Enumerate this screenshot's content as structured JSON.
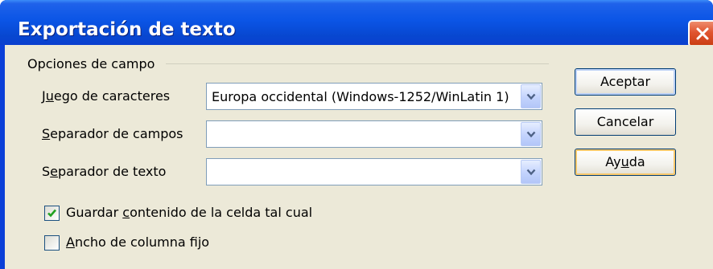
{
  "window": {
    "title": "Exportación de texto"
  },
  "group": {
    "label": "Opciones de campo"
  },
  "fields": [
    {
      "label_pre": "J",
      "label_access": "u",
      "label_post": "ego de caracteres",
      "value": "Europa occidental (Windows-1252/WinLatin 1)"
    },
    {
      "label_pre": "",
      "label_access": "S",
      "label_post": "eparador de campos",
      "value": ""
    },
    {
      "label_pre": "S",
      "label_access": "e",
      "label_post": "parador de texto",
      "value": ""
    }
  ],
  "checkboxes": [
    {
      "label_pre": "Guardar ",
      "label_access": "c",
      "label_post": "ontenido de la celda tal cual",
      "checked": true
    },
    {
      "label_pre": "",
      "label_access": "A",
      "label_post": "ncho de columna fijo",
      "checked": false
    }
  ],
  "buttons": {
    "ok": "Aceptar",
    "cancel": "Cancelar",
    "help_pre": "Ay",
    "help_access": "u",
    "help_post": "da"
  },
  "icons": {
    "close": "close-icon",
    "dropdown": "chevron-down-icon",
    "check": "checkmark-icon"
  },
  "colors": {
    "titlebar": "#0b55e6",
    "close_button": "#e0542f",
    "dialog_background": "#ece9d8",
    "input_border": "#7f9db9",
    "focus_highlight": "#f9c86b"
  }
}
